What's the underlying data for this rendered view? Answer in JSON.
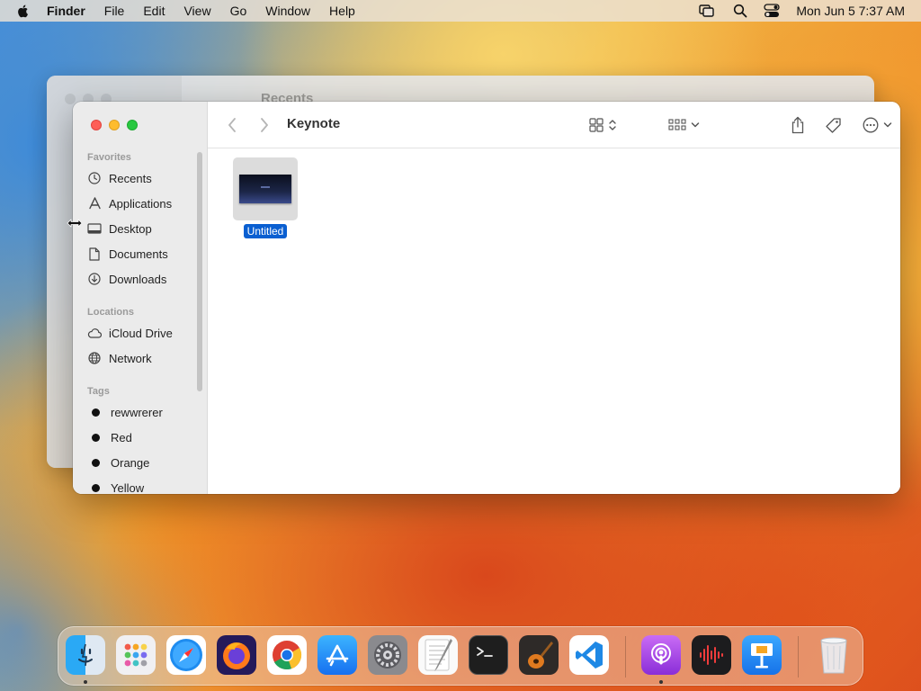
{
  "menubar": {
    "app_name": "Finder",
    "items": [
      "File",
      "Edit",
      "View",
      "Go",
      "Window",
      "Help"
    ],
    "clock": "Mon Jun 5  7:37 AM"
  },
  "background_window": {
    "title": "Recents"
  },
  "window": {
    "title": "Keynote",
    "sidebar": {
      "favorites_label": "Favorites",
      "favorites": [
        {
          "label": "Recents",
          "icon": "clock-icon"
        },
        {
          "label": "Applications",
          "icon": "applications-icon"
        },
        {
          "label": "Desktop",
          "icon": "desktop-icon"
        },
        {
          "label": "Documents",
          "icon": "document-icon"
        },
        {
          "label": "Downloads",
          "icon": "download-icon"
        }
      ],
      "locations_label": "Locations",
      "locations": [
        {
          "label": "iCloud Drive",
          "icon": "cloud-icon"
        },
        {
          "label": "Network",
          "icon": "globe-icon"
        }
      ],
      "tags_label": "Tags",
      "tags": [
        {
          "label": "rewwrerer"
        },
        {
          "label": "Red"
        },
        {
          "label": "Orange"
        },
        {
          "label": "Yellow"
        }
      ]
    },
    "files": [
      {
        "name": "Untitled",
        "selected": true
      }
    ]
  },
  "dock": {
    "apps": [
      "Finder",
      "Launchpad",
      "Safari",
      "Firefox",
      "Chrome",
      "App Store",
      "System Settings",
      "TextEdit",
      "Terminal",
      "GarageBand",
      "Visual Studio Code",
      "Podcasts",
      "Voice Memos",
      "Keynote",
      "Trash"
    ]
  },
  "colors": {
    "selection": "#0a5fd1",
    "close": "#fe5f57",
    "minimize": "#febc2e",
    "zoom": "#28c840"
  }
}
